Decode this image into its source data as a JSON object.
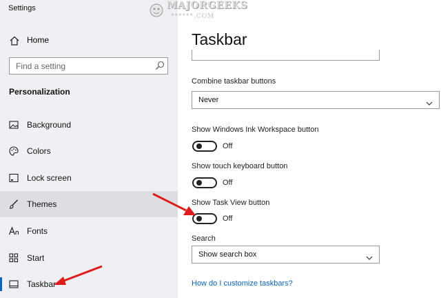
{
  "window": {
    "title": "Settings"
  },
  "sidebar": {
    "home_label": "Home",
    "search_placeholder": "Find a setting",
    "section_title": "Personalization",
    "items": [
      {
        "label": "Background",
        "icon": "picture-icon"
      },
      {
        "label": "Colors",
        "icon": "palette-icon"
      },
      {
        "label": "Lock screen",
        "icon": "monitor-icon"
      },
      {
        "label": "Themes",
        "icon": "brush-icon"
      },
      {
        "label": "Fonts",
        "icon": "font-icon"
      },
      {
        "label": "Start",
        "icon": "start-tiles-icon"
      },
      {
        "label": "Taskbar",
        "icon": "taskbar-icon"
      }
    ],
    "selected": "Taskbar",
    "hovered": "Themes"
  },
  "main": {
    "title": "Taskbar",
    "combine": {
      "label": "Combine taskbar buttons",
      "value": "Never"
    },
    "ink_workspace": {
      "label": "Show Windows Ink Workspace button",
      "state": "Off"
    },
    "touch_keyboard": {
      "label": "Show touch keyboard button",
      "state": "Off"
    },
    "task_view": {
      "label": "Show Task View button",
      "state": "Off"
    },
    "search": {
      "label": "Search",
      "value": "Show search box"
    },
    "help_link": "How do I customize taskbars?"
  },
  "watermark": {
    "text": "MAJORGEEKS",
    "sub": "******.COM"
  },
  "colors": {
    "accent": "#0067c0",
    "link": "#0a62b6",
    "arrow": "#e01b1b",
    "sidebar_bg": "#eef0f3"
  }
}
